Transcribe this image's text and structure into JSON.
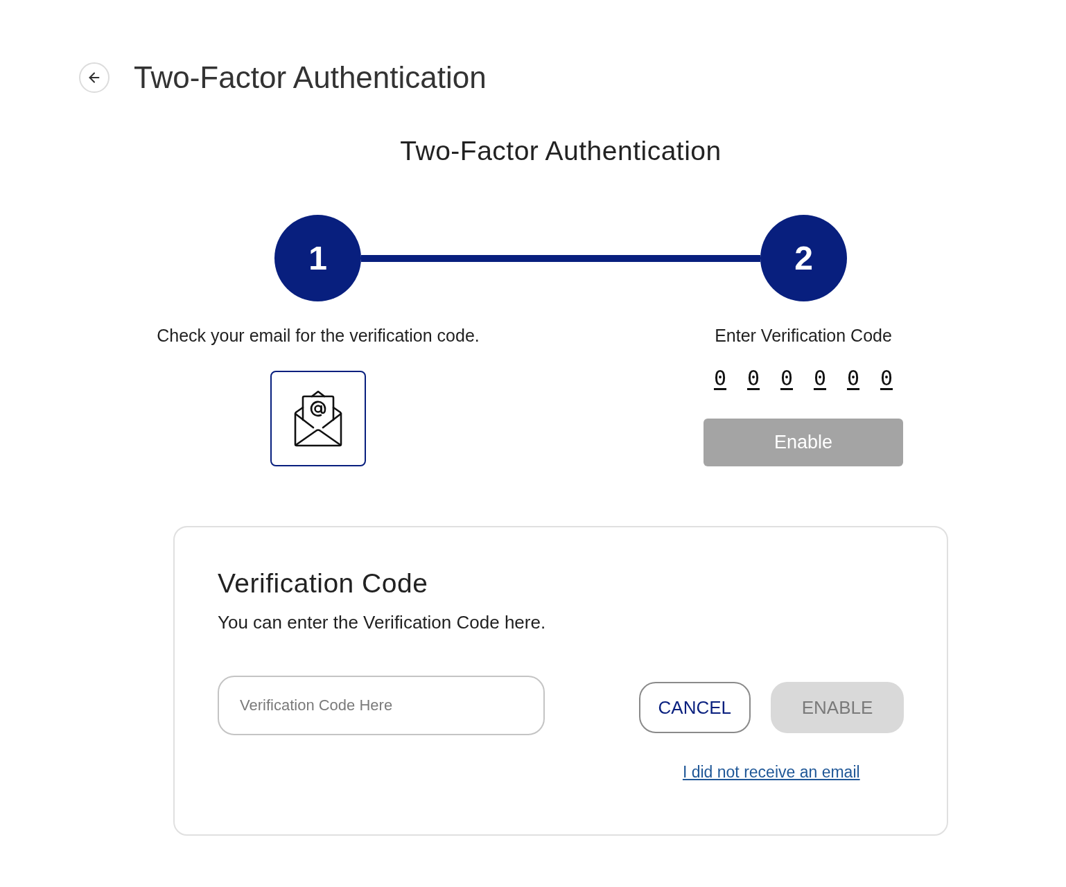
{
  "header": {
    "title": "Two-Factor Authentication"
  },
  "section_title": "Two-Factor Authentication",
  "steps": [
    {
      "number": "1",
      "kind": "email",
      "label": "Check your email for the verification code."
    },
    {
      "number": "2",
      "kind": "code",
      "label": "Enter Verification Code",
      "code_digits": [
        "0",
        "0",
        "0",
        "0",
        "0",
        "0"
      ],
      "button": {
        "label": "Enable",
        "disabled": true
      }
    }
  ],
  "card": {
    "title": "Verification Code",
    "description": "You can enter the Verification Code here.",
    "input": {
      "placeholder": "Verification Code Here"
    },
    "buttons": [
      {
        "label": "CANCEL",
        "kind": "outline",
        "disabled": false
      },
      {
        "label": "ENABLE",
        "kind": "filled",
        "disabled": true
      }
    ],
    "link": "I did not receive an email"
  }
}
